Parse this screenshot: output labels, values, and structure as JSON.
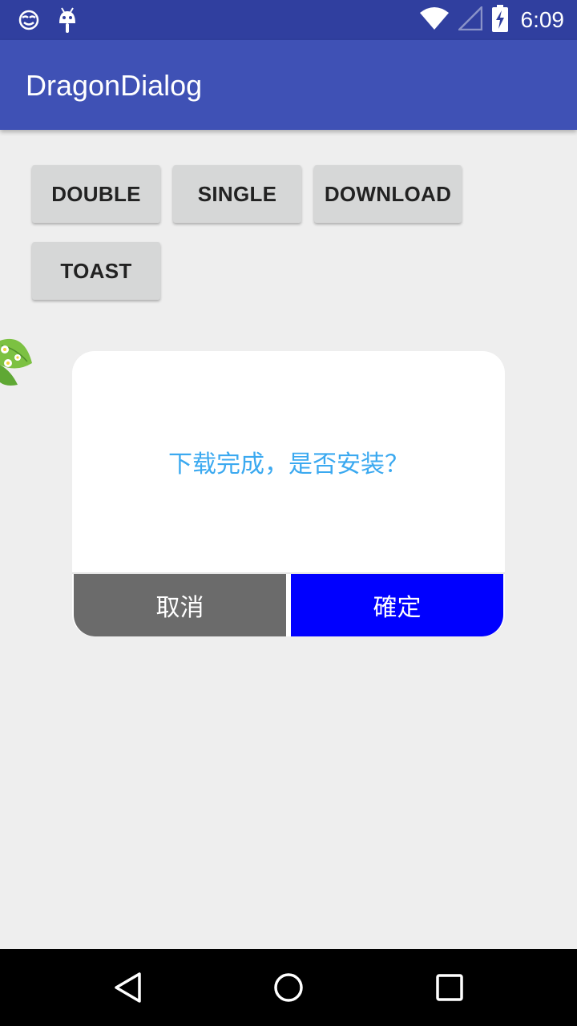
{
  "status_bar": {
    "time": "6:09",
    "icons": [
      "emoji-face-icon",
      "android-robot-icon",
      "wifi-icon",
      "cell-signal-icon",
      "battery-charging-icon"
    ]
  },
  "app_bar": {
    "title": "DragonDialog"
  },
  "buttons": {
    "double": "DOUBLE",
    "single": "SINGLE",
    "download": "DOWNLOAD",
    "toast": "TOAST"
  },
  "dialog": {
    "message": "下载完成，是否安装？",
    "cancel_label": "取消",
    "confirm_label": "確定"
  },
  "nav_bar": {
    "icons": [
      "back-icon",
      "home-icon",
      "recents-icon"
    ]
  },
  "colors": {
    "status_bar": "#303F9F",
    "app_bar": "#3F51B5",
    "background": "#EEEEEE",
    "message_text": "#3BA9F0",
    "cancel_button": "#6B6B6B",
    "confirm_button": "#0000FF"
  }
}
